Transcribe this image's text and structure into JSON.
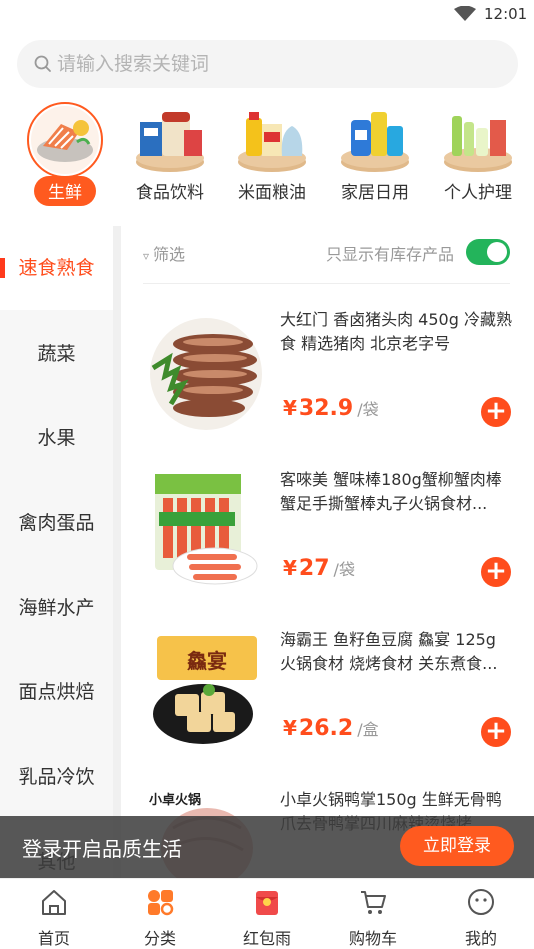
{
  "status": {
    "time": "12:01",
    "wifi_icon": "wifi-icon"
  },
  "search": {
    "placeholder": "请输入搜索关键词",
    "value": ""
  },
  "categories": [
    {
      "label": "生鲜",
      "icon": "salmon-icon",
      "active": true
    },
    {
      "label": "食品饮料",
      "icon": "drinks-icon"
    },
    {
      "label": "米面粮油",
      "icon": "grain-oil-icon"
    },
    {
      "label": "家居日用",
      "icon": "household-icon"
    },
    {
      "label": "个人护理",
      "icon": "personal-care-icon"
    }
  ],
  "sidebar": {
    "items": [
      {
        "label": "速食熟食",
        "active": true
      },
      {
        "label": "蔬菜"
      },
      {
        "label": "水果"
      },
      {
        "label": "禽肉蛋品"
      },
      {
        "label": "海鲜水产"
      },
      {
        "label": "面点烘焙"
      },
      {
        "label": "乳品冷饮"
      },
      {
        "label": "其他"
      }
    ]
  },
  "filter": {
    "label": "筛选",
    "in_stock_label": "只显示有库存产品",
    "in_stock_on": true
  },
  "products": [
    {
      "title": "大红门 香卤猪头肉 450g 冷藏熟食 精选猪肉 北京老字号",
      "currency": "¥",
      "price": "32.9",
      "unit": "/袋"
    },
    {
      "title": "客唻美 蟹味棒180g蟹柳蟹肉棒蟹足手撕蟹棒丸子火锅食材...",
      "currency": "¥",
      "price": "27",
      "unit": "/袋"
    },
    {
      "title": "海霸王 鱼籽鱼豆腐 鱻宴 125g 火锅食材 烧烤食材 关东煮食...",
      "currency": "¥",
      "price": "26.2",
      "unit": "/盒"
    },
    {
      "title": "小卓火锅鸭掌150g 生鲜无骨鸭爪去骨鸭掌四川麻辣烫烧烤...",
      "currency": "",
      "price": "",
      "unit": ""
    }
  ],
  "product_image_text": {
    "seafood_brand": "鱻宴",
    "duck_brand": "小卓火锅"
  },
  "login_banner": {
    "text": "登录开启品质生活",
    "button": "立即登录"
  },
  "tabbar": [
    {
      "label": "首页",
      "icon": "home-icon"
    },
    {
      "label": "分类",
      "icon": "category-icon"
    },
    {
      "label": "红包雨",
      "icon": "red-envelope-icon"
    },
    {
      "label": "购物车",
      "icon": "cart-icon"
    },
    {
      "label": "我的",
      "icon": "profile-icon"
    }
  ],
  "colors": {
    "accent": "#ff4d1c",
    "toggle_on": "#23b45b"
  }
}
